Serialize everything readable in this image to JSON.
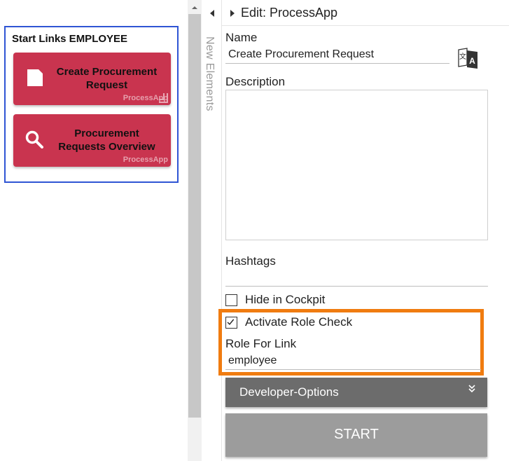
{
  "start_links": {
    "title": "Start Links EMPLOYEE",
    "tiles": [
      {
        "label": "Create Procurement Request",
        "subtitle": "ProcessApp",
        "icon": "document-icon"
      },
      {
        "label": "Procurement Requests Overview",
        "subtitle": "ProcessApp",
        "icon": "search-icon"
      }
    ],
    "tile_color": "#c9344f",
    "box_border_color": "#2f55d4"
  },
  "side_panel": {
    "vertical_label": "New Elements"
  },
  "editor": {
    "header_title": "Edit: ProcessApp",
    "name_label": "Name",
    "name_value": "Create Procurement Request",
    "description_label": "Description",
    "description_value": "",
    "hashtags_label": "Hashtags",
    "hashtags_value": "",
    "hide_in_cockpit_label": "Hide in Cockpit",
    "hide_in_cockpit_checked": false,
    "activate_role_check_label": "Activate Role Check",
    "activate_role_check_checked": true,
    "role_for_link_label": "Role For Link",
    "role_for_link_value": "employee",
    "developer_options_label": "Developer-Options",
    "start_button_label": "START"
  },
  "highlight_color": "#f07c10"
}
